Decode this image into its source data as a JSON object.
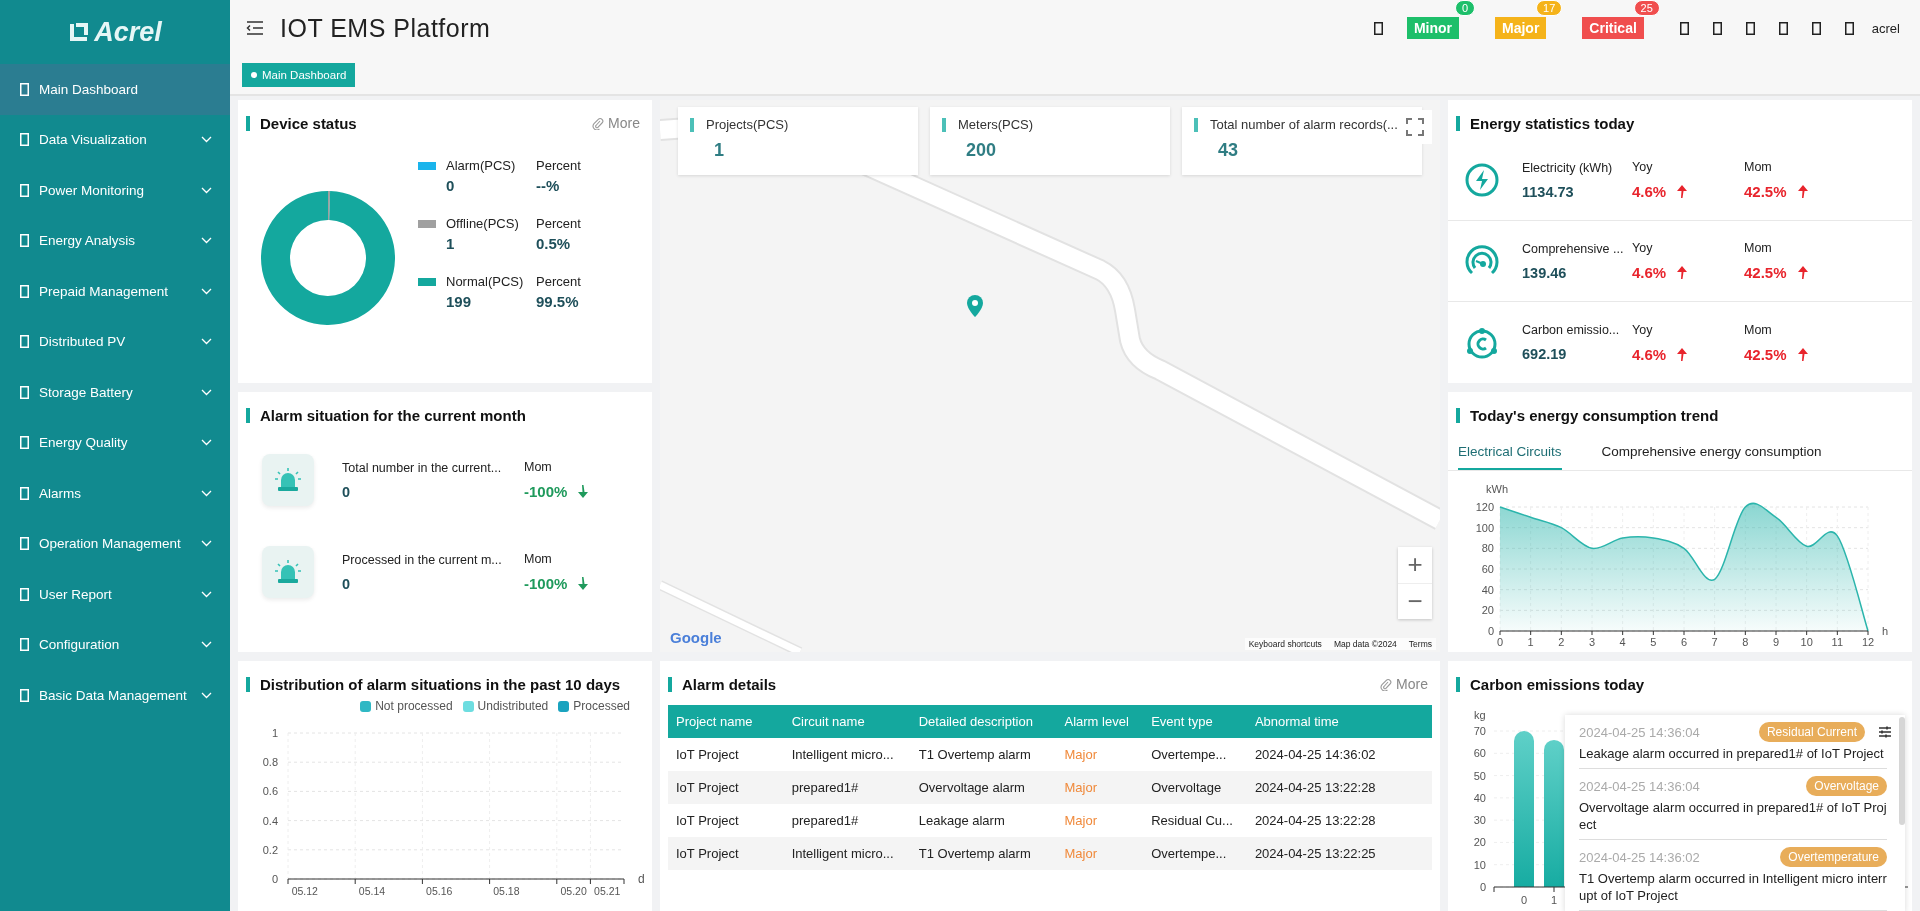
{
  "sidebar": {
    "logo": "Acrel",
    "items": [
      {
        "label": "Main Dashboard",
        "selected": true,
        "expandable": false
      },
      {
        "label": "Data Visualization",
        "selected": false,
        "expandable": true
      },
      {
        "label": "Power Monitoring",
        "selected": false,
        "expandable": true
      },
      {
        "label": "Energy Analysis",
        "selected": false,
        "expandable": true
      },
      {
        "label": "Prepaid Management",
        "selected": false,
        "expandable": true
      },
      {
        "label": "Distributed PV",
        "selected": false,
        "expandable": true
      },
      {
        "label": "Storage Battery",
        "selected": false,
        "expandable": true
      },
      {
        "label": "Energy Quality",
        "selected": false,
        "expandable": true
      },
      {
        "label": "Alarms",
        "selected": false,
        "expandable": true
      },
      {
        "label": "Operation Management",
        "selected": false,
        "expandable": true
      },
      {
        "label": "User Report",
        "selected": false,
        "expandable": true
      },
      {
        "label": "Configuration",
        "selected": false,
        "expandable": true
      },
      {
        "label": "Basic Data Management",
        "selected": false,
        "expandable": true
      }
    ]
  },
  "header": {
    "title": "IOT EMS Platform",
    "alarm_badges": [
      {
        "label": "Minor",
        "count": "0",
        "color": "#1dbf6a"
      },
      {
        "label": "Major",
        "count": "17",
        "color": "#f5b31a"
      },
      {
        "label": "Critical",
        "count": "25",
        "color": "#f04e4e"
      }
    ],
    "user": "acrel"
  },
  "tags": [
    {
      "label": "Main Dashboard",
      "selected": true
    }
  ],
  "device_status": {
    "title": "Device status",
    "more": "More",
    "legend": [
      {
        "value": "0",
        "percent_label": "Percent",
        "percent": "--%",
        "color": "#1ab4ec"
      },
      {
        "value": "1",
        "percent_label": "Percent",
        "percent": "0.5%",
        "color": "#a0a0a0"
      },
      {
        "value": "199",
        "percent_label": "Percent",
        "percent": "99.5%",
        "color": "#14a89e"
      }
    ],
    "chart_data": {
      "type": "donut",
      "categories": [
        "Alarm(PCS)",
        "Offline(PCS)",
        "Normal(PCS)"
      ],
      "values": [
        0,
        0.5,
        99.5
      ]
    }
  },
  "map": {
    "stat_cards": [
      {
        "label": "Projects(PCS)",
        "value": "1"
      },
      {
        "label": "Meters(PCS)",
        "value": "200"
      },
      {
        "label": "Total number of alarm records(...",
        "value": "43"
      }
    ],
    "zoom_in": "+",
    "zoom_out": "−",
    "logo": "Google",
    "attribution": [
      "Keyboard shortcuts",
      "Map data ©2024",
      "Terms"
    ]
  },
  "energy_statistics": {
    "title": "Energy statistics today",
    "rows": [
      {
        "kind": "electricity",
        "label": "Electricity (kWh)",
        "value": "1134.73",
        "yoy_label": "Yoy",
        "yoy": "4.6%",
        "yoy_up": true,
        "mom_label": "Mom",
        "mom": "42.5%",
        "mom_up": true
      },
      {
        "kind": "comprehensive",
        "label": "Comprehensive ...",
        "value": "139.46",
        "yoy_label": "Yoy",
        "yoy": "4.6%",
        "yoy_up": true,
        "mom_label": "Mom",
        "mom": "42.5%",
        "mom_up": true
      },
      {
        "kind": "carbon",
        "label": "Carbon emissio...",
        "value": "692.19",
        "yoy_label": "Yoy",
        "yoy": "4.6%",
        "yoy_up": true,
        "mom_label": "Mom",
        "mom": "42.5%",
        "mom_up": true
      }
    ]
  },
  "alarm_month": {
    "title": "Alarm situation for the current month",
    "rows": [
      {
        "label": "Total number in the current...",
        "value": "0",
        "mom_label": "Mom",
        "mom": "-100%",
        "up": false
      },
      {
        "label": "Processed in the current m...",
        "value": "0",
        "mom_label": "Mom",
        "mom": "-100%",
        "up": false
      }
    ]
  },
  "energy_trend": {
    "title": "Today's energy consumption trend",
    "tabs": [
      {
        "label": "Electrical Circuits",
        "selected": true
      },
      {
        "label": "Comprehensive energy consumption",
        "selected": false
      }
    ],
    "chart_data": {
      "type": "area",
      "ylabel": "kWh",
      "xlabel": "h",
      "x": [
        0,
        1,
        2,
        3,
        4,
        5,
        6,
        7,
        8,
        9,
        10,
        11,
        12
      ],
      "series": [
        {
          "color": "#2bb5ac",
          "values": [
            120,
            110,
            100,
            80,
            90,
            90,
            80,
            50,
            120,
            110,
            82,
            92,
            0
          ]
        }
      ],
      "xticks": [
        0,
        1,
        2,
        3,
        4,
        5,
        6,
        7,
        8,
        9,
        10,
        11,
        12
      ],
      "yticks": [
        0,
        20,
        40,
        60,
        80,
        100,
        120
      ],
      "xlim": [
        0,
        12
      ],
      "ylim": [
        0,
        120
      ],
      "grid": true
    }
  },
  "alarm_distribution": {
    "title": "Distribution of alarm situations in the past 10 days",
    "chart_data": {
      "type": "bar",
      "xlabel": "d",
      "categories": [
        "05.12",
        null,
        "05.14",
        null,
        "05.16",
        null,
        "05.18",
        null,
        "05.20",
        "05.21"
      ],
      "series": [
        {
          "name": "Not processed",
          "color": "#2fb8c4",
          "values": [
            0,
            0,
            0,
            0,
            0,
            0,
            0,
            0,
            0,
            0
          ]
        },
        {
          "name": "Undistributed",
          "color": "#6ddde0",
          "values": [
            0,
            0,
            0,
            0,
            0,
            0,
            0,
            0,
            0,
            0
          ]
        },
        {
          "name": "Processed",
          "color": "#1aa3bf",
          "values": [
            0,
            0,
            0,
            0,
            0,
            0,
            0,
            0,
            0,
            0
          ]
        }
      ],
      "yticks": [
        0,
        0.2,
        0.4,
        0.6,
        0.8,
        1
      ],
      "ylim": [
        0,
        1
      ],
      "grid": true
    }
  },
  "alarm_details": {
    "title": "Alarm details",
    "more": "More",
    "columns": [
      "Project name",
      "Circuit name",
      "Detailed description",
      "Alarm level",
      "Event type",
      "Abnormal time"
    ],
    "rows": [
      {
        "project": "IoT Project",
        "circuit": "Intelligent micro...",
        "description": "T1 Overtemp alarm",
        "level": "Major",
        "event_type": "Overtempe...",
        "time": "2024-04-25 14:36:02"
      },
      {
        "project": "IoT Project",
        "circuit": "prepared1#",
        "description": "Overvoltage alarm",
        "level": "Major",
        "event_type": "Overvoltage",
        "time": "2024-04-25 13:22:28"
      },
      {
        "project": "IoT Project",
        "circuit": "prepared1#",
        "description": "Leakage alarm",
        "level": "Major",
        "event_type": "Residual Cu...",
        "time": "2024-04-25 13:22:28"
      },
      {
        "project": "IoT Project",
        "circuit": "Intelligent micro...",
        "description": "T1 Overtemp alarm",
        "level": "Major",
        "event_type": "Overtempe...",
        "time": "2024-04-25 13:22:25"
      }
    ]
  },
  "carbon_emissions": {
    "title": "Carbon emissions today",
    "chart_data": {
      "type": "bar",
      "ylabel": "kg",
      "categories": [
        "0",
        "1"
      ],
      "series": [
        {
          "color": "#17aca2",
          "values": [
            70,
            66
          ]
        }
      ],
      "yticks": [
        0,
        10,
        20,
        30,
        40,
        50,
        60,
        70
      ],
      "ylim": [
        0,
        70
      ],
      "grid": true
    }
  },
  "notifications": [
    {
      "time": "2024-04-25 14:36:04",
      "tag": "Residual Current",
      "message": "Leakage alarm occurred in prepared1# of IoT Project"
    },
    {
      "time": "2024-04-25 14:36:04",
      "tag": "Overvoltage",
      "message": "Overvoltage alarm occurred in prepared1# of IoT Project"
    },
    {
      "time": "2024-04-25 14:36:02",
      "tag": "Overtemperature",
      "message": "T1 Overtemp alarm occurred in Intelligent micro interrupt of IoT Project"
    }
  ]
}
